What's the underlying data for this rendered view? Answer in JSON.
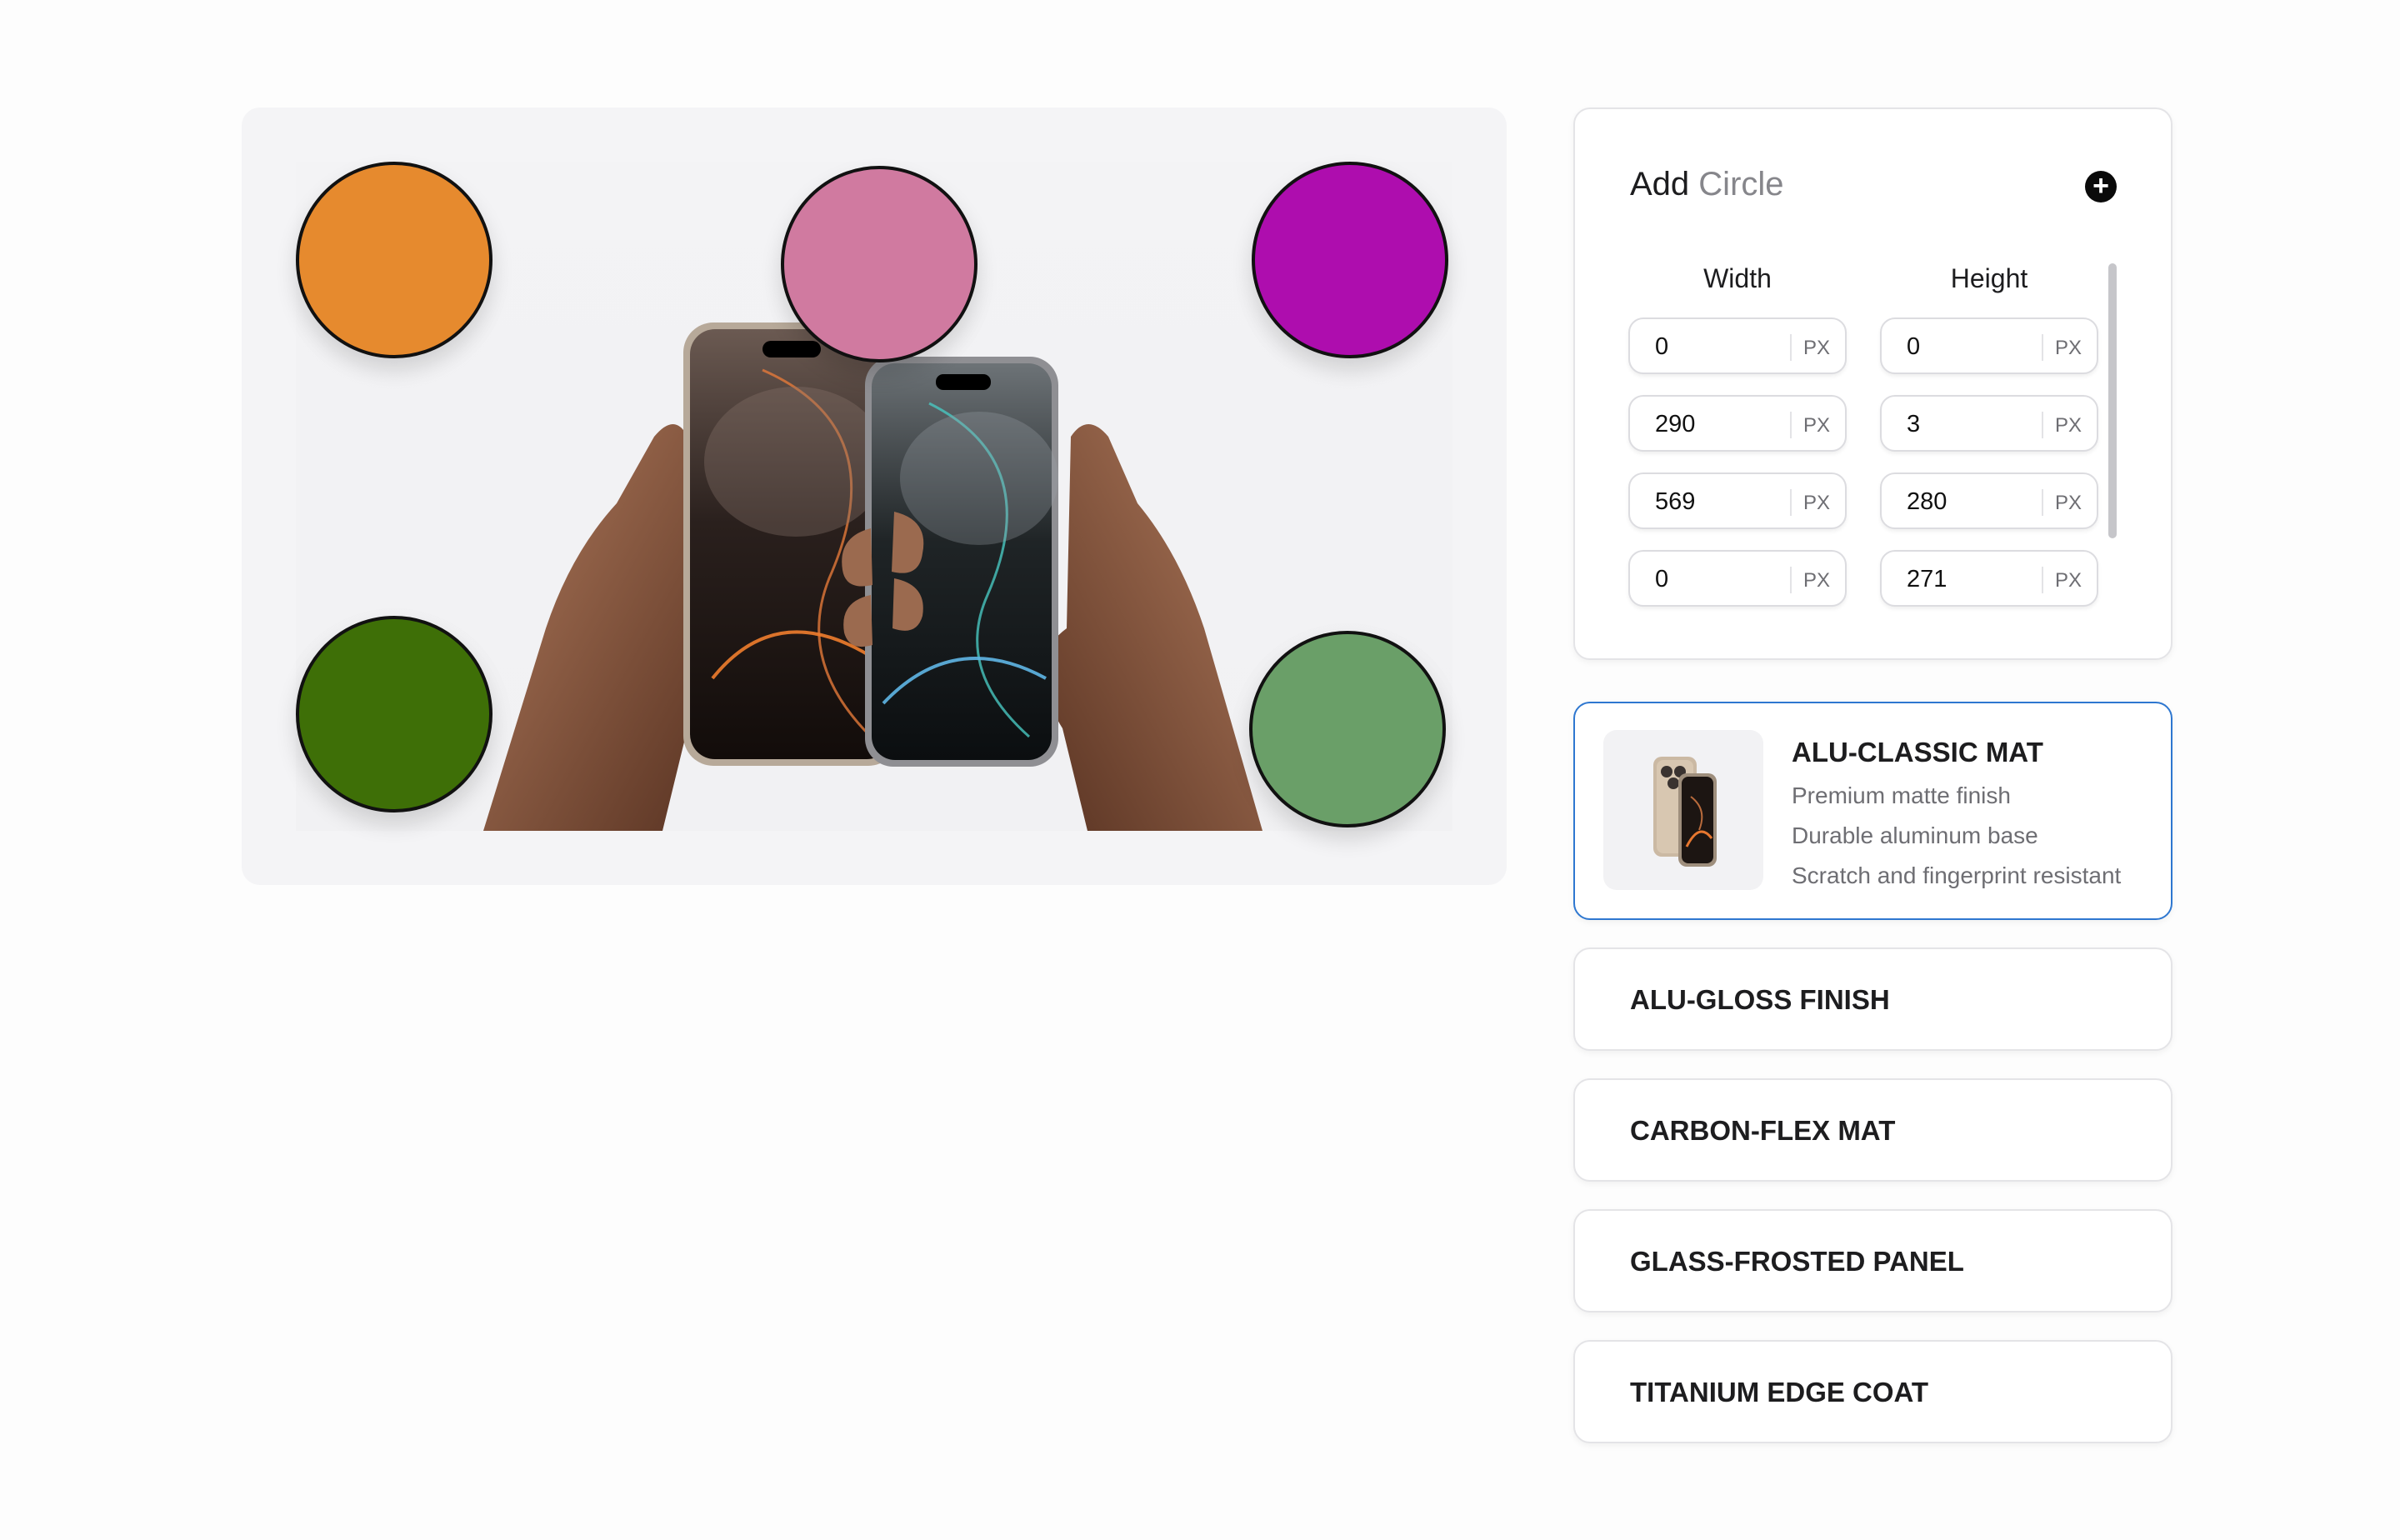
{
  "add_circle": {
    "title_main": "Add",
    "title_accent": "Circle",
    "add_icon": "plus-circle-icon",
    "columns": [
      "Width",
      "Height"
    ],
    "unit": "PX",
    "rows": [
      {
        "width": "0",
        "height": "0"
      },
      {
        "width": "290",
        "height": "3"
      },
      {
        "width": "569",
        "height": "280"
      },
      {
        "width": "0",
        "height": "271"
      }
    ]
  },
  "circles": [
    {
      "name": "orange",
      "color": "#E68A2E"
    },
    {
      "name": "pink",
      "color": "#D07AA0"
    },
    {
      "name": "magenta",
      "color": "#AE0DAE"
    },
    {
      "name": "dark-green",
      "color": "#3E6F07"
    },
    {
      "name": "sage-green",
      "color": "#6A9F68"
    }
  ],
  "materials": {
    "selected": {
      "name": "ALU-CLASSIC MAT",
      "features": [
        "Premium matte finish",
        "Durable aluminum base",
        "Scratch and fingerprint resistant"
      ]
    },
    "others": [
      "ALU-GLOSS FINISH",
      "CARBON-FLEX MAT",
      "GLASS-FROSTED PANEL",
      "TITANIUM EDGE COAT"
    ]
  },
  "colors": {
    "accent_border": "#2E77D0",
    "panel_bg": "#F4F4F6"
  }
}
